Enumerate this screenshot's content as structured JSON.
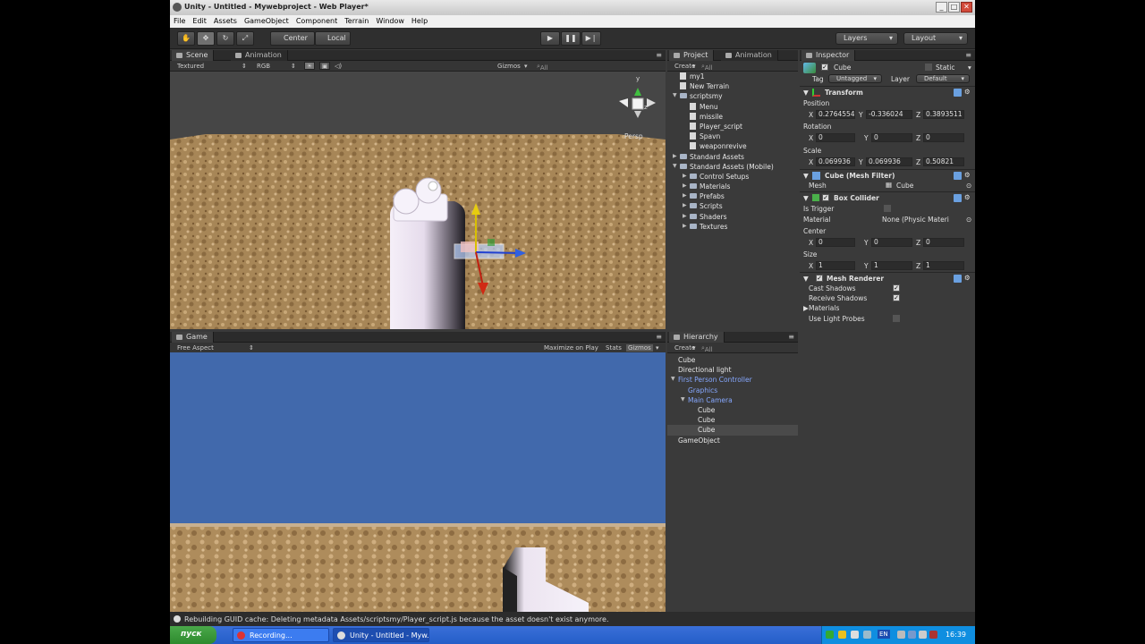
{
  "window": {
    "title": "Unity - Untitled - Mywebproject - Web Player*"
  },
  "menu": [
    "File",
    "Edit",
    "Assets",
    "GameObject",
    "Component",
    "Terrain",
    "Window",
    "Help"
  ],
  "toolbar": {
    "pivot_label": "Center",
    "space_label": "Local",
    "layers_label": "Layers",
    "layout_label": "Layout"
  },
  "scene": {
    "tabs": [
      "Scene",
      "Animation"
    ],
    "render_mode": "Textured",
    "color_mode": "RGB",
    "gizmos_label": "Gizmos",
    "search_label": "All",
    "persp_label": "Persp",
    "gizmo_axes": {
      "x": "x",
      "y": "y",
      "z": "z"
    }
  },
  "game": {
    "tab": "Game",
    "aspect": "Free Aspect",
    "maximize": "Maximize on Play",
    "stats": "Stats",
    "gizmos": "Gizmos"
  },
  "project": {
    "tabs": [
      "Project",
      "Animation"
    ],
    "create_label": "Create",
    "search_label": "All",
    "items": [
      {
        "label": "my1",
        "indent": 0,
        "kind": "file",
        "arrow": ""
      },
      {
        "label": "New Terrain",
        "indent": 0,
        "kind": "file",
        "arrow": ""
      },
      {
        "label": "scriptsmy",
        "indent": 0,
        "kind": "folder",
        "arrow": "▼"
      },
      {
        "label": "Menu",
        "indent": 1,
        "kind": "file",
        "arrow": ""
      },
      {
        "label": "missile",
        "indent": 1,
        "kind": "file",
        "arrow": ""
      },
      {
        "label": "Player_script",
        "indent": 1,
        "kind": "file",
        "arrow": ""
      },
      {
        "label": "Spavn",
        "indent": 1,
        "kind": "file",
        "arrow": ""
      },
      {
        "label": "weaponrevive",
        "indent": 1,
        "kind": "file",
        "arrow": ""
      },
      {
        "label": "Standard Assets",
        "indent": 0,
        "kind": "folder",
        "arrow": "▶"
      },
      {
        "label": "Standard Assets (Mobile)",
        "indent": 0,
        "kind": "folder",
        "arrow": "▼"
      },
      {
        "label": "Control Setups",
        "indent": 1,
        "kind": "folder",
        "arrow": "▶"
      },
      {
        "label": "Materials",
        "indent": 1,
        "kind": "folder",
        "arrow": "▶"
      },
      {
        "label": "Prefabs",
        "indent": 1,
        "kind": "folder",
        "arrow": "▶"
      },
      {
        "label": "Scripts",
        "indent": 1,
        "kind": "folder",
        "arrow": "▶"
      },
      {
        "label": "Shaders",
        "indent": 1,
        "kind": "folder",
        "arrow": "▶"
      },
      {
        "label": "Textures",
        "indent": 1,
        "kind": "folder",
        "arrow": "▶"
      }
    ]
  },
  "hierarchy": {
    "tab": "Hierarchy",
    "create_label": "Create",
    "search_label": "All",
    "items": [
      {
        "label": "Cube",
        "indent": 0,
        "arrow": "",
        "blue": false,
        "selected": false
      },
      {
        "label": "Directional light",
        "indent": 0,
        "arrow": "",
        "blue": false,
        "selected": false
      },
      {
        "label": "First Person Controller",
        "indent": 0,
        "arrow": "▼",
        "blue": true,
        "selected": false
      },
      {
        "label": "Graphics",
        "indent": 1,
        "arrow": "",
        "blue": true,
        "selected": false
      },
      {
        "label": "Main Camera",
        "indent": 1,
        "arrow": "▼",
        "blue": true,
        "selected": false
      },
      {
        "label": "Cube",
        "indent": 2,
        "arrow": "",
        "blue": false,
        "selected": false
      },
      {
        "label": "Cube",
        "indent": 2,
        "arrow": "",
        "blue": false,
        "selected": false
      },
      {
        "label": "Cube",
        "indent": 2,
        "arrow": "",
        "blue": false,
        "selected": true
      },
      {
        "label": "GameObject",
        "indent": 0,
        "arrow": "",
        "blue": false,
        "selected": false
      }
    ]
  },
  "inspector": {
    "tab": "Inspector",
    "object_name": "Cube",
    "static_label": "Static",
    "tag_label": "Tag",
    "tag_value": "Untagged",
    "layer_label": "Layer",
    "layer_value": "Default",
    "transform": {
      "title": "Transform",
      "position_label": "Position",
      "rotation_label": "Rotation",
      "scale_label": "Scale",
      "position": {
        "x": "0.2764554",
        "y": "-0.336024",
        "z": "0.3893511"
      },
      "rotation": {
        "x": "0",
        "y": "0",
        "z": "0"
      },
      "scale": {
        "x": "0.069936",
        "y": "0.069936",
        "z": "0.50821"
      }
    },
    "mesh_filter": {
      "title": "Cube (Mesh Filter)",
      "mesh_label": "Mesh",
      "mesh_value": "Cube"
    },
    "box_collider": {
      "title": "Box Collider",
      "is_trigger_label": "Is Trigger",
      "material_label": "Material",
      "material_value": "None (Physic Materi",
      "center_label": "Center",
      "center": {
        "x": "0",
        "y": "0",
        "z": "0"
      },
      "size_label": "Size",
      "size": {
        "x": "1",
        "y": "1",
        "z": "1"
      }
    },
    "mesh_renderer": {
      "title": "Mesh Renderer",
      "cast_shadows_label": "Cast Shadows",
      "receive_shadows_label": "Receive Shadows",
      "materials_label": "Materials",
      "use_light_probes_label": "Use Light Probes"
    },
    "axis": {
      "x": "X",
      "y": "Y",
      "z": "Z"
    }
  },
  "status": {
    "message": "Rebuilding GUID cache: Deleting metadata Assets/scriptsmy/Player_script.js because the asset doesn't exist anymore."
  },
  "taskbar": {
    "start_label": "пуск",
    "tasks": [
      "Recording...",
      "Unity - Untitled - Myw..."
    ],
    "lang": "EN",
    "clock": "16:39"
  },
  "colors": {
    "sky": "#4169ac",
    "ground": "#a8875a",
    "panel": "#3a3a3a",
    "hierarchy_blue": "#86a8ff"
  }
}
